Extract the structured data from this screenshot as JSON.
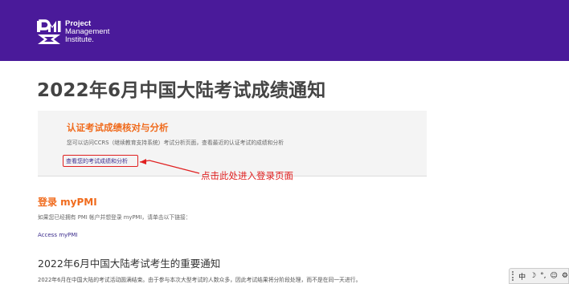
{
  "header": {
    "logo": {
      "line1": "Project",
      "line2": "Management",
      "line3": "Institute."
    },
    "background": "#4a1a9a"
  },
  "page": {
    "title": "2022年6月中国大陆考试成绩通知"
  },
  "results_panel": {
    "title": "认证考试成绩核对与分析",
    "description": "您可以访问CCRS（继续教育支持系统）考试分析页面，查看最近的认证考试的成绩和分析",
    "link_label": "查看您的考试成绩和分析"
  },
  "annotation": {
    "text": "点击此处进入登录页面",
    "color": "#e02020"
  },
  "login_section": {
    "title": "登录 myPMI",
    "description": "如果您已经拥有 PMI 帐户并想登录 myPMI，请单击以下链接：",
    "link_label": "Access myPMI"
  },
  "notice_section": {
    "title": "2022年6月中国大陆考试考生的重要通知",
    "paragraph": "2022年6月在中国大陆的考试活动圆满结束。由于参与本次大型考试的人数众多，因此考试结果将分阶段处理，而不是在同一天进行。"
  },
  "ime_toolbar": {
    "items": [
      "中",
      "☽",
      "°,",
      "☺",
      "⚙"
    ]
  },
  "colors": {
    "accent_orange": "#f06b1d",
    "link_purple": "#3a2b8c",
    "highlight_red": "#e02020"
  }
}
